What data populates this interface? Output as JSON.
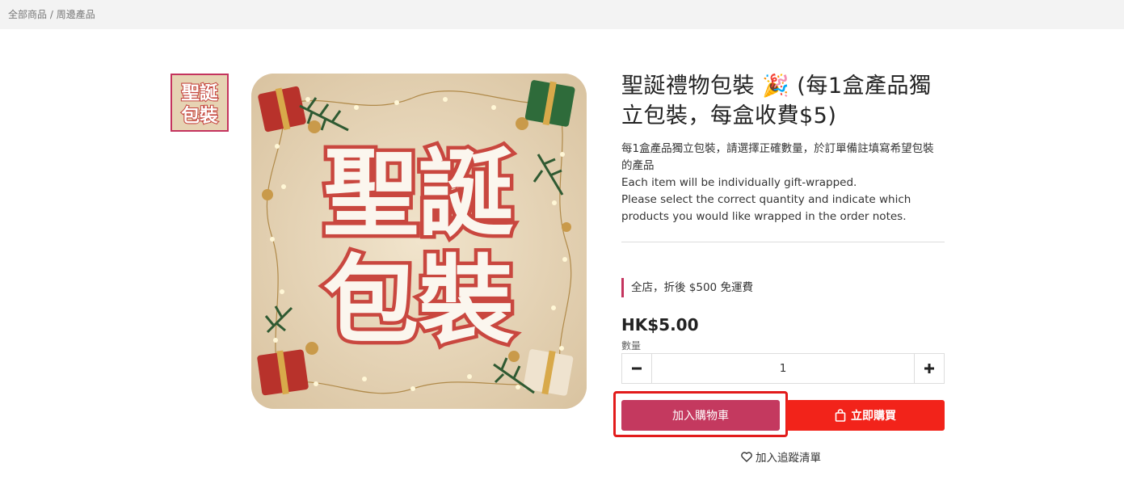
{
  "breadcrumb": {
    "items": [
      "全部商品",
      "周邊產品"
    ],
    "separator": " / "
  },
  "product": {
    "image_text": [
      "聖誕",
      "包裝"
    ],
    "title": "聖誕禮物包裝 🎉 (每1盒產品獨立包裝，每盒收費$5)",
    "description": [
      "每1盒產品獨立包裝，請選擇正確數量，於訂單備註填寫希望包裝",
      "的產品",
      "Each item will be individually gift-wrapped.",
      "Please select the correct quantity and indicate which",
      "products you would like wrapped in the order notes."
    ],
    "promo": "全店，折後 $500 免運費",
    "price": "HK$5.00",
    "quantity_label": "數量",
    "quantity": "1"
  },
  "actions": {
    "add_to_cart": "加入購物車",
    "buy_now": "立即購買",
    "wishlist": "加入追蹤清單",
    "minus": "−",
    "plus": "+"
  },
  "colors": {
    "accent": "#c4395f",
    "buy": "#f2231a",
    "highlight": "#e21b1b"
  },
  "icons": [
    "minus-icon",
    "plus-icon",
    "shopping-bag-icon",
    "heart-icon"
  ]
}
